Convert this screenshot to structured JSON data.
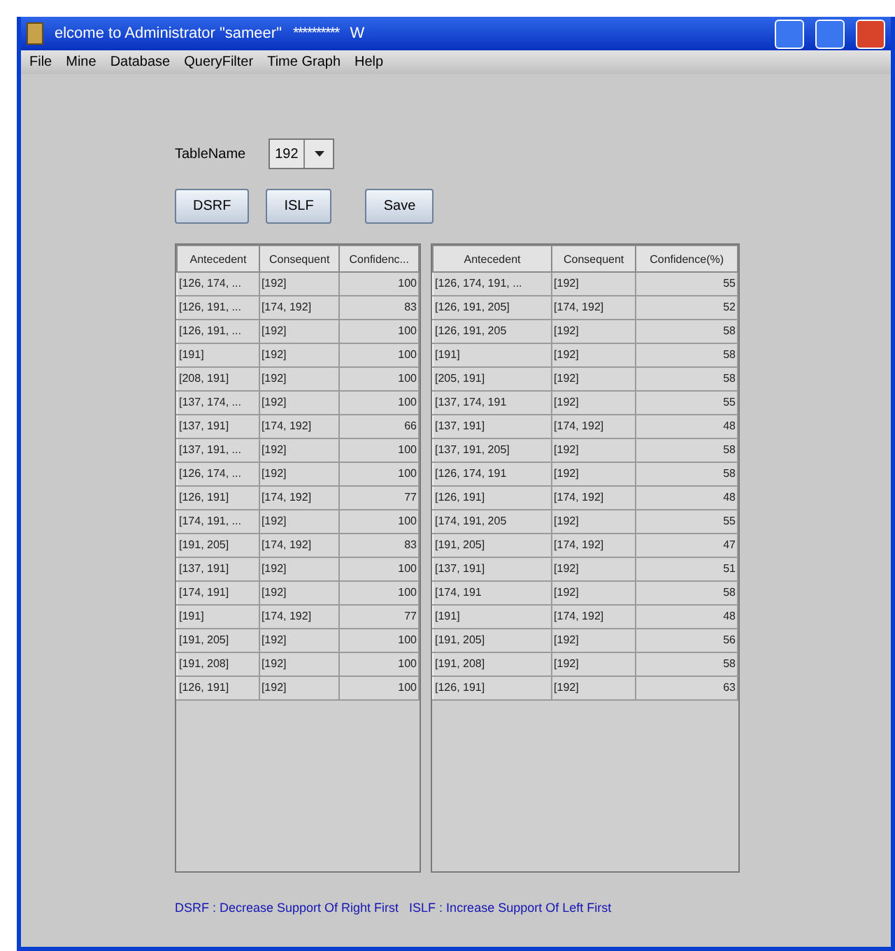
{
  "window": {
    "title": "elcome to Administrator \"sameer\"",
    "title_mask": "**********",
    "title_suffix": "W"
  },
  "menu": [
    "File",
    "Mine",
    "Database",
    "QueryFilter",
    "Time Graph",
    "Help"
  ],
  "table_name": {
    "label": "TableName",
    "value": "192"
  },
  "buttons": [
    "DSRF",
    "ISLF",
    "Save"
  ],
  "tables": [
    {
      "columns": [
        "Antecedent",
        "Consequent",
        "Confidenc..."
      ],
      "rows": [
        [
          "[126, 174, ...",
          "[192]",
          "100"
        ],
        [
          "[126, 191, ...",
          "[174, 192]",
          "83"
        ],
        [
          "[126, 191, ...",
          "[192]",
          "100"
        ],
        [
          "[191]",
          "[192]",
          "100"
        ],
        [
          "[208, 191]",
          "[192]",
          "100"
        ],
        [
          "[137, 174, ...",
          "[192]",
          "100"
        ],
        [
          "[137, 191]",
          "[174, 192]",
          "66"
        ],
        [
          "[137, 191, ...",
          "[192]",
          "100"
        ],
        [
          "[126, 174, ...",
          "[192]",
          "100"
        ],
        [
          "[126, 191]",
          "[174, 192]",
          "77"
        ],
        [
          "[174, 191, ...",
          "[192]",
          "100"
        ],
        [
          "[191, 205]",
          "[174, 192]",
          "83"
        ],
        [
          "[137, 191]",
          "[192]",
          "100"
        ],
        [
          "[174, 191]",
          "[192]",
          "100"
        ],
        [
          "[191]",
          "[174, 192]",
          "77"
        ],
        [
          "[191, 205]",
          "[192]",
          "100"
        ],
        [
          "[191, 208]",
          "[192]",
          "100"
        ],
        [
          "[126, 191]",
          "[192]",
          "100"
        ]
      ]
    },
    {
      "columns": [
        "Antecedent",
        "Consequent",
        "Confidence(%)"
      ],
      "rows": [
        [
          "[126, 174, 191, ...",
          "[192]",
          "55"
        ],
        [
          "[126, 191, 205]",
          "[174, 192]",
          "52"
        ],
        [
          "[126, 191, 205",
          "[192]",
          "58"
        ],
        [
          "[191]",
          "[192]",
          "58"
        ],
        [
          "[205, 191]",
          "[192]",
          "58"
        ],
        [
          "[137, 174, 191",
          "[192]",
          "55"
        ],
        [
          "[137, 191]",
          "[174, 192]",
          "48"
        ],
        [
          "[137, 191, 205]",
          "[192]",
          "58"
        ],
        [
          "[126, 174, 191",
          "[192]",
          "58"
        ],
        [
          "[126, 191]",
          "[174, 192]",
          "48"
        ],
        [
          "[174, 191, 205",
          "[192]",
          "55"
        ],
        [
          "[191, 205]",
          "[174, 192]",
          "47"
        ],
        [
          "[137, 191]",
          "[192]",
          "51"
        ],
        [
          "[174, 191",
          "[192]",
          "58"
        ],
        [
          "[191]",
          "[174, 192]",
          "48"
        ],
        [
          "[191, 205]",
          "[192]",
          "56"
        ],
        [
          "[191, 208]",
          "[192]",
          "58"
        ],
        [
          "[126, 191]",
          "[192]",
          "63"
        ]
      ]
    }
  ],
  "legend": "DSRF : Decrease Support Of Right First   ISLF : Increase Support Of Left First"
}
